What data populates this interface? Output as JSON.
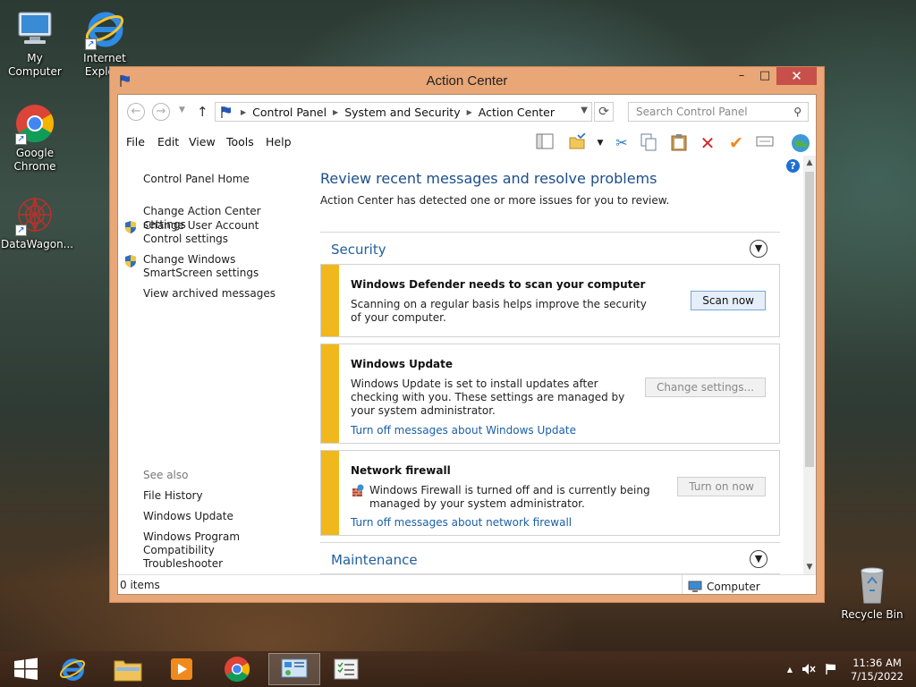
{
  "desktop": {
    "icons": [
      {
        "label": "My Computer"
      },
      {
        "label": "Internet Explo..."
      },
      {
        "label": "Google Chrome"
      },
      {
        "label": "DataWagon..."
      },
      {
        "label": "Recycle Bin"
      }
    ]
  },
  "window": {
    "title": "Action Center",
    "controls": {
      "minimize": "–",
      "maximize": "□",
      "close": "✕"
    }
  },
  "addressbar": {
    "breadcrumbs": [
      "Control Panel",
      "System and Security",
      "Action Center"
    ],
    "search_placeholder": "Search Control Panel"
  },
  "menu": {
    "items": [
      "File",
      "Edit",
      "View",
      "Tools",
      "Help"
    ]
  },
  "sidebar": {
    "home": "Control Panel Home",
    "links": [
      {
        "label": "Change Action Center settings",
        "shield": false
      },
      {
        "label": "Change User Account Control settings",
        "shield": true
      },
      {
        "label": "Change Windows SmartScreen settings",
        "shield": true
      },
      {
        "label": "View archived messages",
        "shield": false
      }
    ],
    "see_also_heading": "See also",
    "see_also": [
      {
        "label": "File History"
      },
      {
        "label": "Windows Update"
      },
      {
        "label": "Windows Program Compatibility Troubleshooter"
      }
    ]
  },
  "main": {
    "title": "Review recent messages and resolve problems",
    "subtitle": "Action Center has detected one or more issues for you to review.",
    "sections": {
      "security": "Security",
      "maintenance": "Maintenance"
    },
    "messages": [
      {
        "title": "Windows Defender needs to scan your computer",
        "text": "Scanning on a regular basis helps improve the security of your computer.",
        "button": "Scan now",
        "link": ""
      },
      {
        "title": "Windows Update",
        "text": "Windows Update is set to install updates after checking with you.  These settings are managed by your system administrator.",
        "button": "Change settings...",
        "link": "Turn off messages about Windows Update"
      },
      {
        "title": "Network firewall",
        "text": "Windows Firewall is turned off and is currently being managed by your system administrator.",
        "button": "Turn on now",
        "link": "Turn off messages about network firewall"
      }
    ]
  },
  "statusbar": {
    "items_count": "0 items",
    "location": "Computer"
  },
  "taskbar": {
    "time": "11:36 AM",
    "date": "7/15/2022"
  },
  "colors": {
    "window_frame": "#e9a676",
    "close_button": "#c7504b",
    "warning_bar": "#f1b81d",
    "link_blue": "#1a5fa8",
    "heading_blue": "#1c4e8c"
  }
}
